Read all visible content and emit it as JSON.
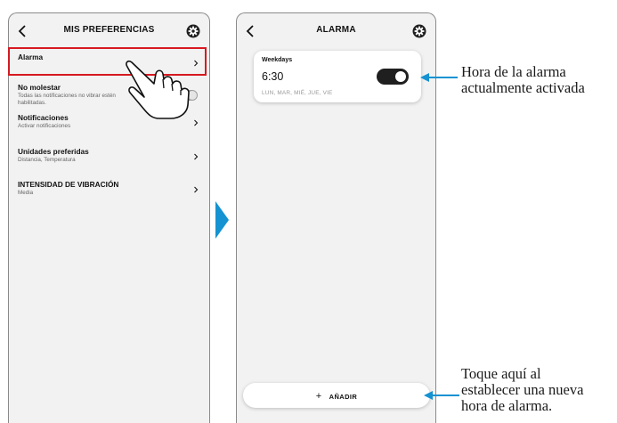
{
  "left_screen": {
    "title": "MIS PREFERENCIAS",
    "items": [
      {
        "label": "Alarma",
        "sublabel": ""
      },
      {
        "label": "No molestar",
        "sublabel": "Todas las notificaciones no vibrar estén habilitadas."
      },
      {
        "label": "Notificaciones",
        "sublabel": "Activar notificaciones"
      },
      {
        "label": "Unidades preferidas",
        "sublabel": "Distancia, Temperatura"
      },
      {
        "label": "INTENSIDAD DE VIBRACIÓN",
        "sublabel": "Media"
      }
    ]
  },
  "right_screen": {
    "title": "ALARMA",
    "alarm": {
      "label": "Weekdays",
      "time": "6:30",
      "days": "LUN, MAR, MIÉ, JUE, VIE",
      "enabled": true
    },
    "add_button": {
      "plus": "+",
      "label": "AÑADIR"
    }
  },
  "annotations": {
    "top": [
      "Hora de la alarma",
      "actualmente activada"
    ],
    "bottom": [
      "Toque aquí al",
      "establecer una nueva",
      "hora de alarma."
    ]
  },
  "icons": {
    "back": "chevron-left-icon",
    "settings": "gear-icon",
    "row_arrow": "chevron-right-icon",
    "hand": "pointing-hand-icon"
  },
  "colors": {
    "highlight": "#d71920",
    "accent_blue": "#1592d1",
    "toggle_on": "#1f1f1f",
    "screen_bg": "#f2f2f2"
  }
}
